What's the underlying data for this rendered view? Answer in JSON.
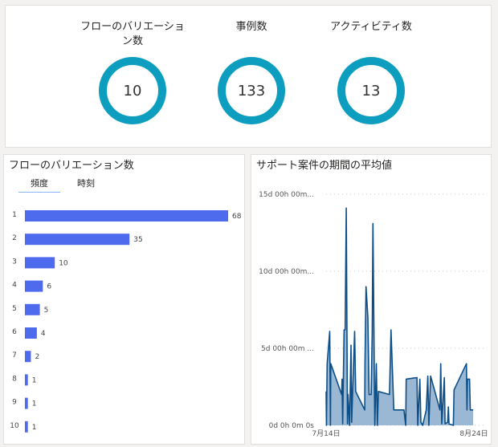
{
  "kpis": [
    {
      "title": "フローのバリエーション数",
      "value": "10"
    },
    {
      "title": "事例数",
      "value": "133"
    },
    {
      "title": "アクティビティ数",
      "value": "13"
    }
  ],
  "colors": {
    "donut": "#0d9ebf",
    "bar": "#4f6bed",
    "line": "#0b4f8a",
    "area": "#9ab8d3"
  },
  "variations": {
    "title": "フローのバリエーション数",
    "tabs": [
      {
        "label": "頻度",
        "active": true
      },
      {
        "label": "時刻",
        "active": false
      }
    ],
    "chart_data": {
      "type": "bar",
      "orientation": "horizontal",
      "categories": [
        "1",
        "2",
        "3",
        "4",
        "5",
        "6",
        "7",
        "8",
        "9",
        "10"
      ],
      "values": [
        68,
        35,
        10,
        6,
        5,
        4,
        2,
        1,
        1,
        1
      ]
    }
  },
  "duration": {
    "title": "サポート案件の期間の平均値",
    "chart_data": {
      "type": "area",
      "x_ticks": [
        "7月14日",
        "8月24日"
      ],
      "y_ticks": [
        "0d 0h 0m 0s",
        "5d 00h 00m ...",
        "10d 00h 00m...",
        "15d 00h 00m..."
      ],
      "y_unit": "days",
      "ylim": [
        0,
        15
      ],
      "grid": "dotted-horizontal",
      "points": [
        [
          "07-14 00:00",
          2.2
        ],
        [
          "07-14 02:00",
          0
        ],
        [
          "07-14 07:00",
          4
        ],
        [
          "07-15 00:00",
          6.1
        ],
        [
          "07-15 05:00",
          0
        ],
        [
          "07-15 07:00",
          4
        ],
        [
          "07-18 07:00",
          2
        ],
        [
          "07-18 10:00",
          3
        ],
        [
          "07-18 14:00",
          0.1
        ],
        [
          "07-19 00:00",
          6.2
        ],
        [
          "07-19 07:00",
          6.2
        ],
        [
          "07-19 14:00",
          14.1
        ],
        [
          "07-19 22:00",
          0.1
        ],
        [
          "07-20 02:00",
          2
        ],
        [
          "07-20 12:00",
          0
        ],
        [
          "07-20 22:00",
          5.2
        ],
        [
          "07-21 02:00",
          0.2
        ],
        [
          "07-21 22:00",
          6.1
        ],
        [
          "07-22 05:00",
          2.2
        ],
        [
          "07-24 17:00",
          1
        ],
        [
          "07-24 19:00",
          4
        ],
        [
          "07-25 02:00",
          9
        ],
        [
          "07-25 14:00",
          7
        ],
        [
          "07-25 22:00",
          2
        ],
        [
          "07-26 12:00",
          2
        ],
        [
          "07-26 19:00",
          6
        ],
        [
          "07-27 00:00",
          13.1
        ],
        [
          "07-27 12:00",
          0
        ],
        [
          "07-27 22:00",
          4
        ],
        [
          "07-28 05:00",
          0
        ],
        [
          "07-28 12:00",
          2.2
        ],
        [
          "07-31 14:00",
          2
        ],
        [
          "08-01 00:00",
          6.2
        ],
        [
          "08-01 19:00",
          1
        ],
        [
          "08-04 14:00",
          1
        ],
        [
          "08-05 02:00",
          0
        ],
        [
          "08-05 05:00",
          3
        ],
        [
          "08-08 05:00",
          3.1
        ],
        [
          "08-08 10:00",
          0
        ],
        [
          "08-09 00:00",
          3
        ],
        [
          "08-09 07:00",
          0.2
        ],
        [
          "08-09 19:00",
          0
        ],
        [
          "08-10 19:00",
          1
        ],
        [
          "08-11 05:00",
          3.2
        ],
        [
          "08-11 12:00",
          0
        ],
        [
          "08-12 00:00",
          3.2
        ],
        [
          "08-14 14:00",
          1
        ],
        [
          "08-14 19:00",
          4
        ],
        [
          "08-15 02:00",
          0.1
        ],
        [
          "08-15 19:00",
          3.1
        ],
        [
          "08-16 00:00",
          0.1
        ],
        [
          "08-16 17:00",
          0.2
        ],
        [
          "08-16 22:00",
          1.2
        ],
        [
          "08-17 02:00",
          0.1
        ],
        [
          "08-18 07:00",
          0
        ],
        [
          "08-18 12:00",
          2.3
        ],
        [
          "08-21 22:00",
          4
        ],
        [
          "08-22 02:00",
          1
        ],
        [
          "08-22 05:00",
          3
        ],
        [
          "08-22 19:00",
          3
        ],
        [
          "08-23 00:00",
          1
        ],
        [
          "08-23 19:00",
          1
        ]
      ]
    }
  }
}
